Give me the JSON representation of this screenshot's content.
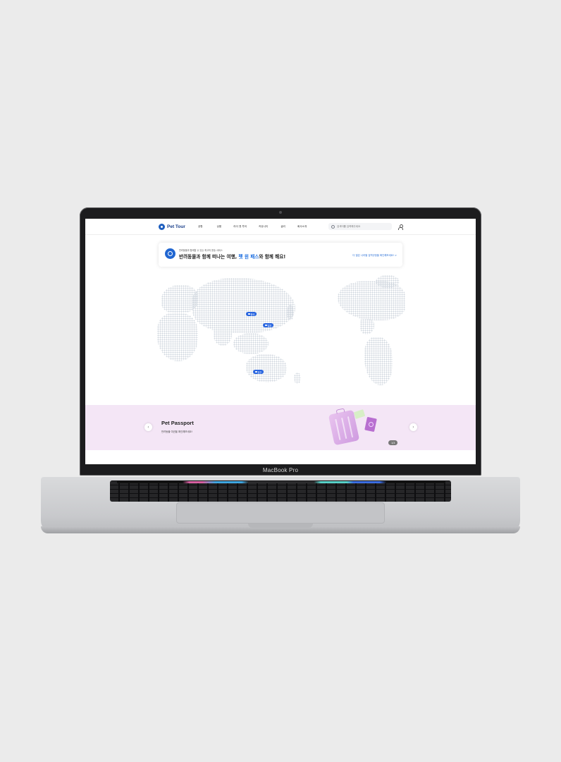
{
  "device": {
    "label": "MacBook Pro"
  },
  "header": {
    "logo_text": "Pet Tour",
    "nav": [
      "공항",
      "상품",
      "라이 앤 투어",
      "커뮤니티",
      "굴리",
      "회사소개"
    ],
    "search_placeholder": "검색어를 입력해주세요"
  },
  "banner": {
    "subtitle": "반려동물과 함께할 수 있는 최고의 운송 서비스",
    "title_prefix": "반려동물과 함께 떠나는 여행, ",
    "title_highlight": "펫 원 패스",
    "title_suffix": "와 함께 해요!",
    "link": "더 많은 나라별 검역규정을 확인해보세요! >"
  },
  "map": {
    "pins": [
      "중국",
      "일본",
      "호주"
    ]
  },
  "promo": {
    "title": "Pet Passport",
    "subtitle": "반려동물 여권을 확인해보세요!",
    "prev_label": "‹",
    "next_label": "›",
    "pager": "1/3"
  },
  "colors": {
    "brand": "#1f5fbf",
    "accent": "#1e6fe0",
    "pin": "#2a66e0",
    "promo_bg": "#f4e6f6"
  }
}
